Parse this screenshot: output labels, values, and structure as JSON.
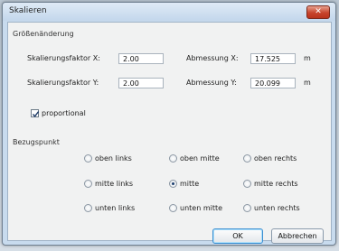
{
  "window": {
    "title": "Skalieren",
    "close_glyph": "✕"
  },
  "resize_group": {
    "title": "Größenänderung"
  },
  "scale_x": {
    "label": "Skalierungsfaktor X:",
    "value": "2.00"
  },
  "scale_y": {
    "label": "Skalierungsfaktor Y:",
    "value": "2.00"
  },
  "dim_x": {
    "label": "Abmessung X:",
    "value": "17.525",
    "unit": "m"
  },
  "dim_y": {
    "label": "Abmessung Y:",
    "value": "20.099",
    "unit": "m"
  },
  "proportional": {
    "label": "proportional",
    "checked": true
  },
  "reference_group": {
    "title": "Bezugspunkt"
  },
  "reference_options": [
    {
      "label": "oben links",
      "selected": false
    },
    {
      "label": "oben mitte",
      "selected": false
    },
    {
      "label": "oben rechts",
      "selected": false
    },
    {
      "label": "mitte links",
      "selected": false
    },
    {
      "label": "mitte",
      "selected": true
    },
    {
      "label": "mitte rechts",
      "selected": false
    },
    {
      "label": "unten links",
      "selected": false
    },
    {
      "label": "unten mitte",
      "selected": false
    },
    {
      "label": "unten rechts",
      "selected": false
    }
  ],
  "buttons": {
    "ok": "OK",
    "cancel": "Abbrechen"
  }
}
